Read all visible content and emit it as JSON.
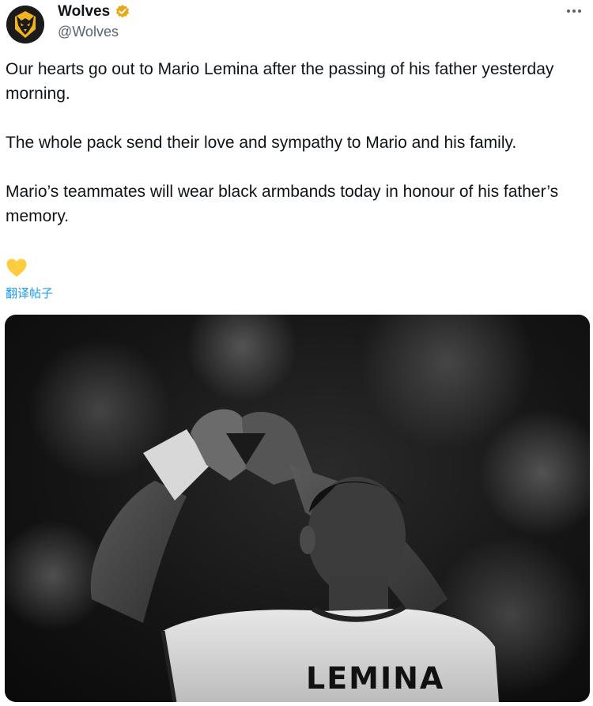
{
  "account": {
    "display_name": "Wolves",
    "handle": "@Wolves",
    "verified_badge_color": "#e6a817"
  },
  "tweet": {
    "paragraphs": [
      "Our hearts go out to Mario Lemina after the passing of his father yesterday morning.",
      "The whole pack send their love and sympathy to Mario and his family.",
      "Mario’s teammates will wear black armbands today in honour of his father’s memory."
    ],
    "emoji": "yellow-heart",
    "translate_link": "翻译帖子"
  },
  "photo": {
    "style": "black-and-white",
    "shirt_name": "LEMINA"
  },
  "icons": {
    "avatar": "wolves-crest-icon",
    "verified": "verified-badge-icon",
    "more": "more-options-icon"
  }
}
